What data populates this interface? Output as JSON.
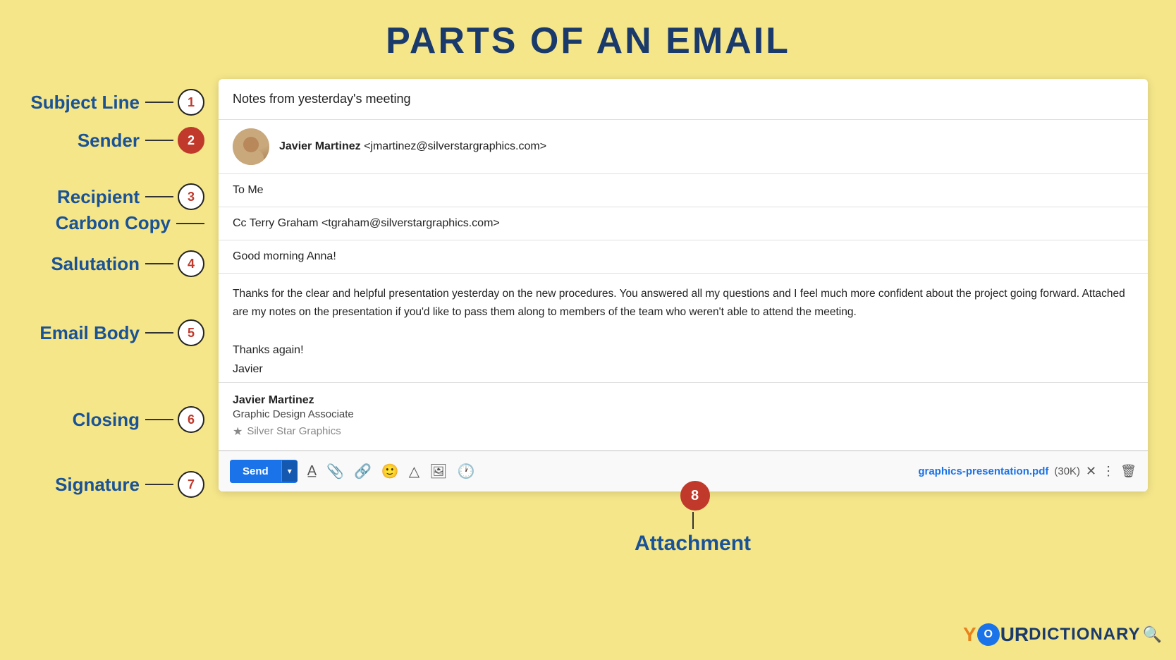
{
  "title": "PARTS OF AN EMAIL",
  "labels": {
    "subject_line": "Subject Line",
    "sender": "Sender",
    "recipient": "Recipient",
    "carbon_copy": "Carbon Copy",
    "salutation": "Salutation",
    "email_body": "Email Body",
    "closing": "Closing",
    "signature": "Signature",
    "attachment": "Attachment"
  },
  "numbers": [
    "1",
    "2",
    "3",
    "4",
    "5",
    "6",
    "7",
    "8"
  ],
  "email": {
    "subject": "Notes from yesterday's meeting",
    "sender_name": "Javier Martinez",
    "sender_email": "<jmartinez@silverstargraphics.com>",
    "recipient": "To Me",
    "cc": "Cc Terry Graham <tgraham@silverstargraphics.com>",
    "salutation": "Good morning Anna!",
    "body": "Thanks for the clear and helpful presentation yesterday on the new procedures. You answered all my questions and I feel much more confident about the project going forward. Attached are my notes on the presentation if you'd like to pass them along to members of the team who weren't able to attend the meeting.",
    "closing_line1": "Thanks again!",
    "closing_line2": "Javier",
    "sig_name": "Javier Martinez",
    "sig_title": "Graphic Design Associate",
    "sig_company": "Silver Star Graphics"
  },
  "toolbar": {
    "send_label": "Send",
    "attachment_name": "graphics-presentation.pdf",
    "attachment_size": "(30K)"
  }
}
